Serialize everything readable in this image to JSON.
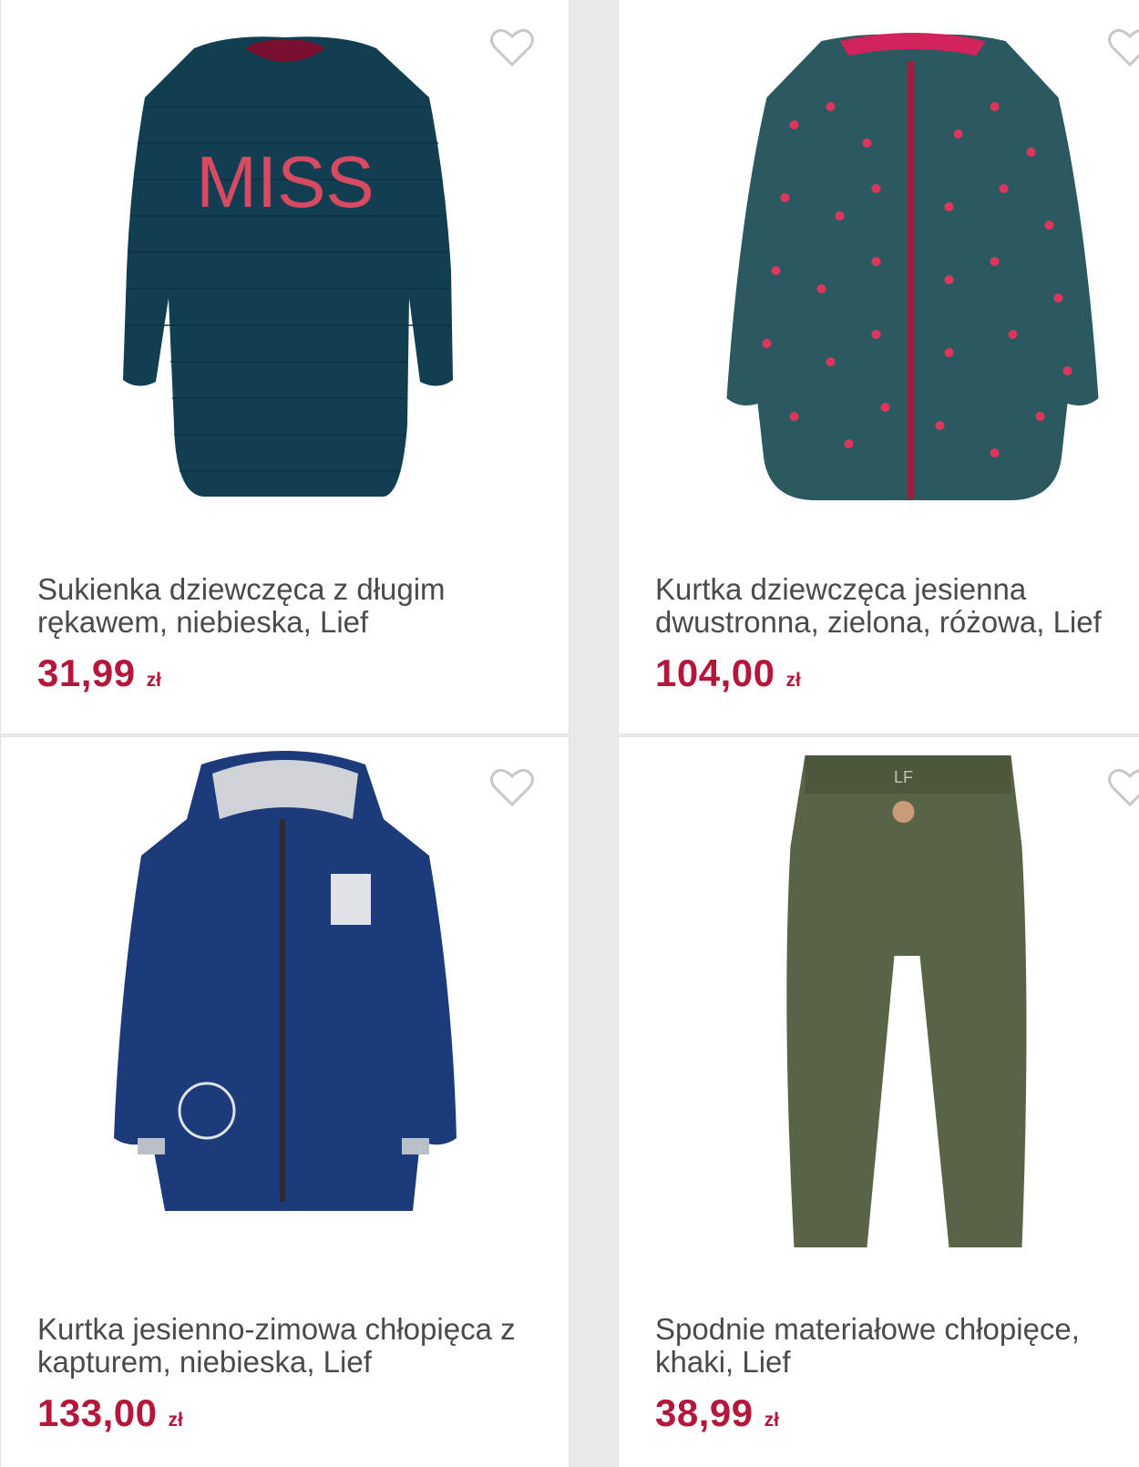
{
  "products": [
    {
      "title": "Sukienka dziewczęca z długim rękawem, niebieska, Lief",
      "price": "31,99",
      "currency": "zł",
      "image": "navy-dress-miss-print",
      "favorite_icon": "heart-outline-icon"
    },
    {
      "title": "Kurtka dziewczęca jesienna dwustronna, zielona, różowa, Lief",
      "price": "104,00",
      "currency": "zł",
      "image": "green-polka-dot-puffer-jacket",
      "favorite_icon": "heart-outline-icon"
    },
    {
      "title": "Kurtka jesienno-zimowa chłopięca z kapturem, niebieska, Lief",
      "price": "133,00",
      "currency": "zł",
      "image": "navy-hooded-winter-jacket",
      "favorite_icon": "heart-outline-icon"
    },
    {
      "title": "Spodnie materiałowe chłopięce, khaki, Lief",
      "price": "38,99",
      "currency": "zł",
      "image": "khaki-trousers",
      "favorite_icon": "heart-outline-icon"
    }
  ],
  "colors": {
    "price": "#b4173a",
    "title": "#4a4a4a",
    "heart": "#c8c8c8",
    "background": "#e9e9e9"
  }
}
